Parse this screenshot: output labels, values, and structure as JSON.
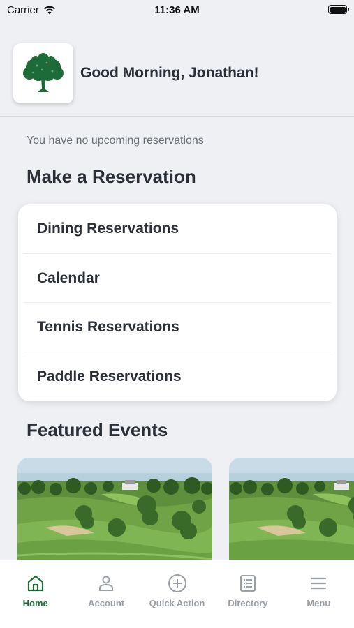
{
  "status_bar": {
    "carrier": "Carrier",
    "time": "11:36 AM"
  },
  "header": {
    "greeting": "Good Morning, Jonathan!",
    "logo_icon": "oak-tree-icon"
  },
  "reservations": {
    "empty_message": "You have no upcoming reservations"
  },
  "make_reservation": {
    "title": "Make a Reservation",
    "items": [
      {
        "label": "Dining Reservations"
      },
      {
        "label": "Calendar"
      },
      {
        "label": "Tennis Reservations"
      },
      {
        "label": "Paddle Reservations"
      }
    ]
  },
  "featured": {
    "title": "Featured Events"
  },
  "tabs": [
    {
      "label": "Home",
      "icon": "home-icon",
      "active": true
    },
    {
      "label": "Account",
      "icon": "person-icon",
      "active": false
    },
    {
      "label": "Quick Action",
      "icon": "plus-circle-icon",
      "active": false
    },
    {
      "label": "Directory",
      "icon": "list-icon",
      "active": false
    },
    {
      "label": "Menu",
      "icon": "hamburger-icon",
      "active": false
    }
  ],
  "colors": {
    "brand_green": "#1e6b3a",
    "background": "#eef0f4",
    "inactive_tab": "#9aa0a8"
  }
}
